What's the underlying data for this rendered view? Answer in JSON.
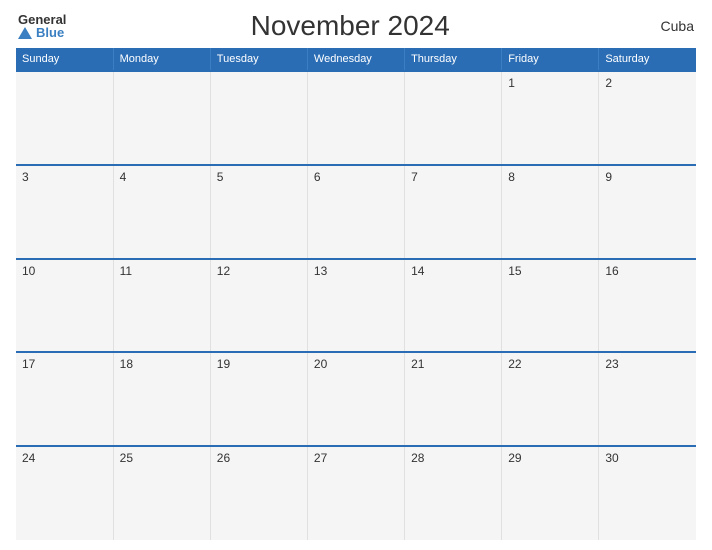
{
  "logo": {
    "general": "General",
    "blue": "Blue",
    "triangle_color": "#3a7fc1"
  },
  "header": {
    "title": "November 2024",
    "country": "Cuba"
  },
  "weekdays": [
    "Sunday",
    "Monday",
    "Tuesday",
    "Wednesday",
    "Thursday",
    "Friday",
    "Saturday"
  ],
  "weeks": [
    [
      null,
      null,
      null,
      null,
      null,
      1,
      2
    ],
    [
      3,
      4,
      5,
      6,
      7,
      8,
      9
    ],
    [
      10,
      11,
      12,
      13,
      14,
      15,
      16
    ],
    [
      17,
      18,
      19,
      20,
      21,
      22,
      23
    ],
    [
      24,
      25,
      26,
      27,
      28,
      29,
      30
    ]
  ]
}
